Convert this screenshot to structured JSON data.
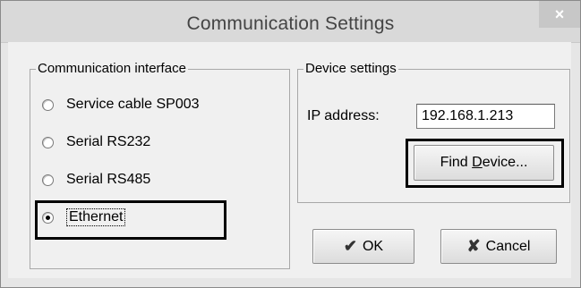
{
  "window": {
    "title": "Communication Settings",
    "close_glyph": "×"
  },
  "interface_group": {
    "label": "Communication interface",
    "options": [
      {
        "label": "Service cable SP003",
        "checked": false
      },
      {
        "label": "Serial RS232",
        "checked": false
      },
      {
        "label": "Serial RS485",
        "checked": false
      },
      {
        "label": "Ethernet",
        "checked": true
      }
    ]
  },
  "device_group": {
    "label": "Device settings",
    "ip_label": "IP address:",
    "ip_value": "192.168.1.213",
    "find_button": {
      "before": "Find ",
      "mnemonic": "D",
      "after": "evice..."
    }
  },
  "buttons": {
    "ok_label": "OK",
    "ok_icon": "checkmark-icon",
    "cancel_label": "Cancel",
    "cancel_icon": "cancel-x-icon"
  }
}
